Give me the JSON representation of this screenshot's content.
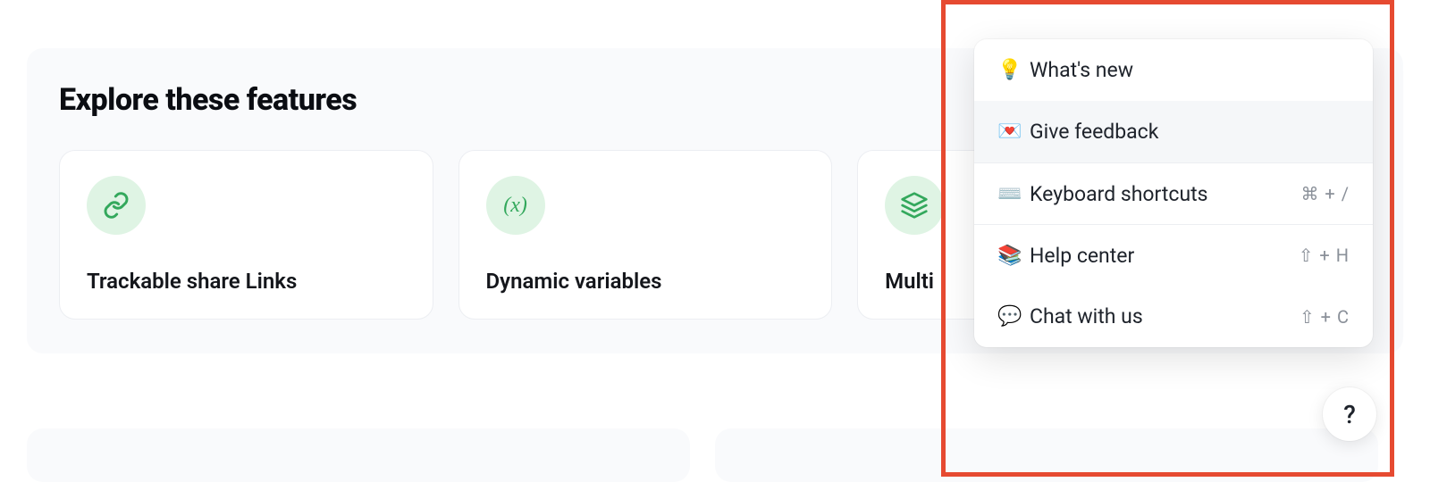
{
  "explore": {
    "title": "Explore these features",
    "cards": [
      {
        "icon": "link-icon",
        "label": "Trackable share Links"
      },
      {
        "icon": "variable-icon",
        "label": "Dynamic variables"
      },
      {
        "icon": "layers-icon",
        "label": "Multi"
      }
    ]
  },
  "help_menu": {
    "items": [
      {
        "emoji": "💡",
        "label": "What's new",
        "shortcut": ""
      },
      {
        "emoji": "💌",
        "label": "Give feedback",
        "shortcut": ""
      },
      {
        "emoji": "⌨️",
        "label": "Keyboard shortcuts",
        "shortcut": "⌘ + /"
      },
      {
        "emoji": "📚",
        "label": "Help center",
        "shortcut": "⇧ + H"
      },
      {
        "emoji": "💬",
        "label": "Chat with us",
        "shortcut": "⇧ + C"
      }
    ]
  },
  "help_fab": {
    "label": "?"
  }
}
